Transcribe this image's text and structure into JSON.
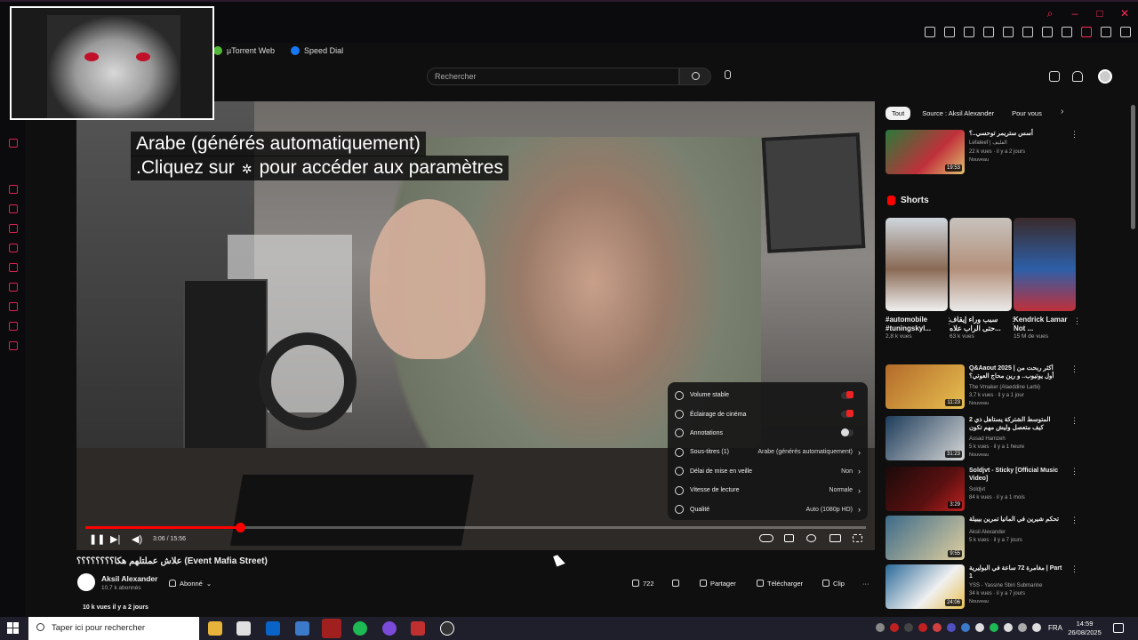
{
  "browser": {
    "bookmarks": [
      {
        "label": "µTorrent Web",
        "icon": "utorrent-icon",
        "color": "#53b83a"
      },
      {
        "label": "Speed Dial",
        "icon": "facebook-icon",
        "color": "#1877f2"
      }
    ]
  },
  "header": {
    "search_placeholder": "Rechercher"
  },
  "video": {
    "captions": [
      "Arabe (générés automatiquement)",
      ".Cliquez sur",
      "pour accéder aux paramètres"
    ],
    "time": "3:06 / 15:56",
    "progress_fraction": 0.198,
    "title": "علاش عملتلهم هكا؟؟؟؟؟؟؟؟ (Event Mafia Street)",
    "channel": "Aksil Alexander",
    "subscribers": "10,7 k abonnés",
    "subscribe_label": "Abonné",
    "likes": "722",
    "share_label": "Partager",
    "download_label": "Télécharger",
    "clip_label": "Clip",
    "views_line": "10 k vues  il y a 2 jours"
  },
  "settings_menu": {
    "items": [
      {
        "label": "Volume stable",
        "value": "",
        "kind": "toggle-on"
      },
      {
        "label": "Éclairage de cinéma",
        "value": "",
        "kind": "toggle-on"
      },
      {
        "label": "Annotations",
        "value": "",
        "kind": "toggle-off"
      },
      {
        "label": "Sous-titres (1)",
        "value": "Arabe (générés automatiquement)",
        "kind": "submenu"
      },
      {
        "label": "Délai de mise en veille",
        "value": "Non",
        "kind": "submenu"
      },
      {
        "label": "Vitesse de lecture",
        "value": "Normale",
        "kind": "submenu"
      },
      {
        "label": "Qualité",
        "value": "Auto (1080p HD)",
        "kind": "submenu"
      }
    ]
  },
  "sidebar_right": {
    "chips": [
      "Tout",
      "Source : Aksil Alexander",
      "Pour vous"
    ],
    "first_rec": {
      "title": "أسس ستريمر توحسي..؟",
      "channel": "Lefaleef | الفليف",
      "meta": "22 k vues · il y a 2 jours",
      "badge": "Nouveau",
      "duration": "19:53"
    },
    "shorts_label": "Shorts",
    "shorts": [
      {
        "title": "#automobile #tuningskyl...",
        "views": "2,8 k vues",
        "color": "#cfd6dc"
      },
      {
        "title": "سبب وراء إيقاف حتى الراب علاه...",
        "views": "63 k vues",
        "color": "#b3907a"
      },
      {
        "title": "Kendrick Lamar Not ...",
        "views": "15 M de vues",
        "color": "#2d5fa8"
      }
    ],
    "recs": [
      {
        "title": "Q&Aaout 2025 | أكثر ربحت من أول يوتيوب.. و رين محاج العوتي؟",
        "channel": "The Vmaker (Alaeddine Larbi)",
        "meta": "3,7 k vues · il y a 1 jour",
        "badge": "Nouveau",
        "duration": "11:23",
        "color": "#b36a2a"
      },
      {
        "title": "المتوسط الشتركة يستاهل ذي 2 كيف متعصل وليش مهم تكون ملتزل؟",
        "channel": "Assad Hamzeh",
        "meta": "5 k vues · il y a 1 heure",
        "badge": "Nouveau",
        "duration": "31:23",
        "color": "#1d3c5a"
      },
      {
        "title": "Soldjvt - Sticky [Official Music Video]",
        "channel": "Soldjvt",
        "meta": "84 k vues · il y a 1 mois",
        "badge": "",
        "duration": "3:29",
        "color": "#5a1010"
      },
      {
        "title": "تحكم شيرين في المانيا تمرين بيبيلة",
        "channel": "Aksil Alexander",
        "meta": "5 k vues · il y a 7 jours",
        "badge": "",
        "duration": "9:55",
        "color": "#3c6a8a"
      },
      {
        "title": "مغامرة 72 ساعة في البوليرية | Part 1",
        "channel": "YSS - Yassine Sbiri Submarine",
        "meta": "34 k vues · il y a 7 jours",
        "badge": "Nouveau",
        "duration": "24:06",
        "color": "#2a6a9a"
      }
    ]
  },
  "taskbar": {
    "search_placeholder": "Taper ici pour rechercher",
    "language": "FRA",
    "time": "14:59",
    "date": "26/08/2025"
  }
}
